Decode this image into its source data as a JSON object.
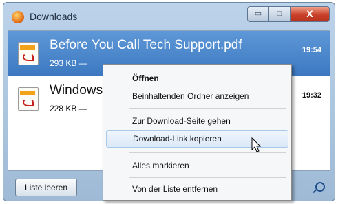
{
  "window": {
    "title": "Downloads",
    "buttons": {
      "min": "▭",
      "max": "□",
      "close": "X"
    }
  },
  "downloads": [
    {
      "name": "Before You Call Tech Support.pdf",
      "meta": "293 KB — ",
      "time": "19:54",
      "selected": true
    },
    {
      "name": "Windows",
      "meta": "228 KB — ",
      "time": "19:32",
      "selected": false
    }
  ],
  "footer": {
    "clear_label": "Liste leeren"
  },
  "context_menu": {
    "items": [
      {
        "label": "Öffnen",
        "bold": true
      },
      {
        "label": "Beinhaltenden Ordner anzeigen"
      },
      {
        "label": "Zur Download-Seite gehen"
      },
      {
        "label": "Download-Link kopieren",
        "highlighted": true
      },
      {
        "label": "Alles markieren"
      },
      {
        "label": "Von der Liste entfernen"
      }
    ]
  },
  "colors": {
    "selection": "#3c78c0",
    "firefox_orange": "#e5731a",
    "close_red": "#c9412a"
  }
}
